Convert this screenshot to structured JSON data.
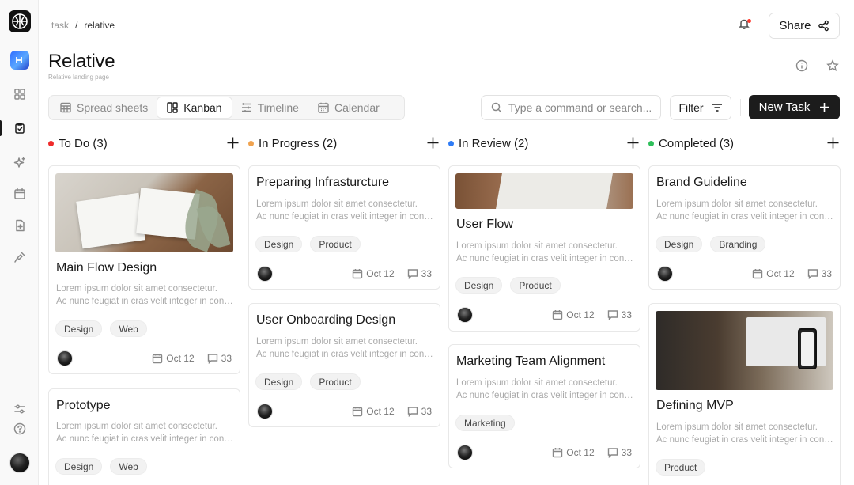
{
  "breadcrumb": {
    "parent": "task",
    "separator": "/",
    "current": "relative"
  },
  "header": {
    "title": "Relative",
    "subtitle": "Relative landing page"
  },
  "share": {
    "label": "Share"
  },
  "view_tabs": [
    {
      "label": "Spread sheets",
      "icon": "table-icon"
    },
    {
      "label": "Kanban",
      "icon": "kanban-icon",
      "active": true
    },
    {
      "label": "Timeline",
      "icon": "timeline-icon"
    },
    {
      "label": "Calendar",
      "icon": "calendar-icon"
    }
  ],
  "search": {
    "placeholder": "Type a command or search..."
  },
  "filter": {
    "label": "Filter"
  },
  "new_task": {
    "label": "New Task"
  },
  "colors": {
    "todo": "#ef2b2b",
    "progress": "#f0a350",
    "review": "#2f7cf6",
    "completed": "#2fbf5a",
    "primary": "#1c1c1c"
  },
  "columns": [
    {
      "name": "To Do (3)",
      "cards": [
        {
          "title": "Main Flow Design",
          "desc1": "Lorem ipsum dolor sit amet consectetur.",
          "desc2": "Ac nunc feugiat in cras velit integer in consequat",
          "tags": [
            "Design",
            "Web"
          ],
          "date": "Oct 12",
          "comments": "33"
        },
        {
          "title": "Prototype",
          "desc1": "Lorem ipsum dolor sit amet consectetur.",
          "desc2": "Ac nunc feugiat in cras velit integer in consequat",
          "tags": [
            "Design",
            "Web"
          ]
        }
      ]
    },
    {
      "name": "In Progress (2)",
      "cards": [
        {
          "title": "Preparing Infrasturcture",
          "desc1": "Lorem ipsum dolor sit amet consectetur.",
          "desc2": "Ac nunc feugiat in cras velit integer in consequat",
          "tags": [
            "Design",
            "Product"
          ],
          "date": "Oct 12",
          "comments": "33"
        },
        {
          "title": "User Onboarding Design",
          "desc1": "Lorem ipsum dolor sit amet consectetur.",
          "desc2": "Ac nunc feugiat in cras velit integer in consequat",
          "tags": [
            "Design",
            "Product"
          ],
          "date": "Oct 12",
          "comments": "33"
        }
      ]
    },
    {
      "name": "In Review (2)",
      "cards": [
        {
          "title": "User Flow",
          "desc1": "Lorem ipsum dolor sit amet consectetur.",
          "desc2": "Ac nunc feugiat in cras velit integer in consequat",
          "tags": [
            "Design",
            "Product"
          ],
          "date": "Oct 12",
          "comments": "33"
        },
        {
          "title": "Marketing Team Alignment",
          "desc1": "Lorem ipsum dolor sit amet consectetur.",
          "desc2": "Ac nunc feugiat in cras velit integer in consequat",
          "tags": [
            "Marketing"
          ],
          "date": "Oct 12",
          "comments": "33"
        }
      ]
    },
    {
      "name": "Completed (3)",
      "cards": [
        {
          "title": "Brand Guideline",
          "desc1": "Lorem ipsum dolor sit amet consectetur.",
          "desc2": "Ac nunc feugiat in cras velit integer in consequat",
          "tags": [
            "Design",
            "Branding"
          ],
          "date": "Oct 12",
          "comments": "33"
        },
        {
          "title": "Defining MVP",
          "desc1": "Lorem ipsum dolor sit amet consectetur.",
          "desc2": "Ac nunc feugiat in cras velit integer in consequat",
          "tags": [
            "Product"
          ]
        }
      ]
    }
  ]
}
